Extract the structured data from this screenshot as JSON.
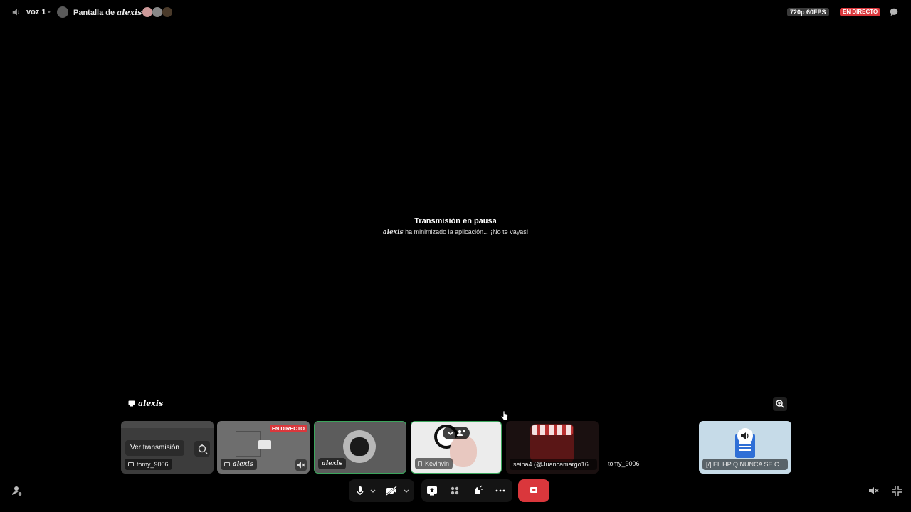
{
  "header": {
    "voice_channel": "voz 1",
    "separator": "•",
    "screen_title_prefix": "Pantalla de",
    "screen_owner": "alexis",
    "quality": "720p 60FPS",
    "live_badge": "EN DIRECTO"
  },
  "stage": {
    "pause_title": "Transmisión en pausa",
    "pause_user": "alexis",
    "pause_message": "ha minimizado la aplicación... ¡No te vayas!",
    "stream_label": "alexis"
  },
  "tiles": [
    {
      "name": "tomy_9006",
      "button": "Ver transmisión"
    },
    {
      "name": "alexis",
      "badge": "EN DIRECTO"
    },
    {
      "name": "alexis"
    },
    {
      "name": "Kevinvin"
    },
    {
      "name": "seiba4 (@Juancamargo16..."
    },
    {
      "name": "tomy_9006"
    },
    {
      "name": "[/] EL HP Q NUNCA SE C..."
    }
  ],
  "colors": {
    "live_red": "#da373c",
    "speaking_green": "#3ba55c",
    "background": "#000000"
  },
  "icons": [
    "speaker-icon",
    "screen-share-icon",
    "chat-icon",
    "zoom-icon",
    "popout-icon",
    "microphone-icon",
    "camera-off-icon",
    "share-screen-icon",
    "activities-icon",
    "soundboard-icon",
    "more-icon",
    "hangup-icon",
    "add-user-icon",
    "volume-mute-icon",
    "exit-fullscreen-icon"
  ]
}
